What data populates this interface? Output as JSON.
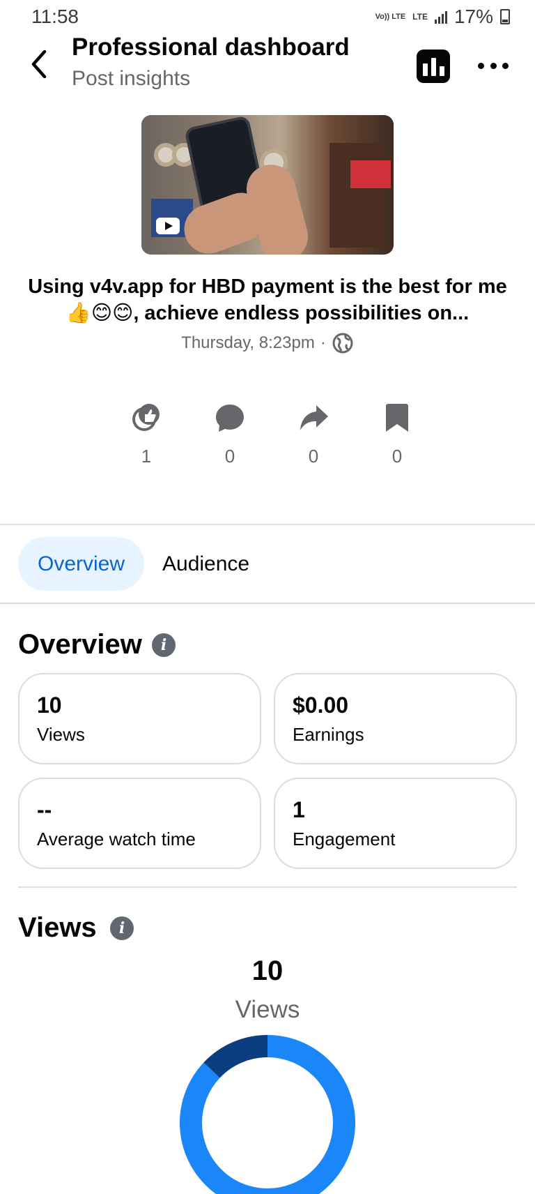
{
  "status_bar": {
    "time": "11:58",
    "volte": "Vo)) LTE",
    "lte": "LTE",
    "battery": "17%"
  },
  "header": {
    "title": "Professional dashboard",
    "subtitle": "Post insights"
  },
  "post": {
    "caption": "Using v4v.app for HBD payment is the best for me 👍😊😊, achieve endless possibilities on...",
    "time": "Thursday, 8:23pm",
    "separator": "·"
  },
  "engagement": [
    {
      "icon": "reactions-icon",
      "count": "1"
    },
    {
      "icon": "comment-icon",
      "count": "0"
    },
    {
      "icon": "share-icon",
      "count": "0"
    },
    {
      "icon": "bookmark-icon",
      "count": "0"
    }
  ],
  "tabs": {
    "overview": "Overview",
    "audience": "Audience",
    "active": "overview"
  },
  "overview": {
    "title": "Overview",
    "cards": [
      {
        "value": "10",
        "label": "Views"
      },
      {
        "value": "$0.00",
        "label": "Earnings"
      },
      {
        "value": "--",
        "label": "Average watch time"
      },
      {
        "value": "1",
        "label": "Engagement"
      }
    ]
  },
  "views": {
    "title": "Views",
    "total": "10",
    "total_label": "Views"
  },
  "chart_data": {
    "type": "pie",
    "values": [
      8.7,
      1.3
    ],
    "colors": [
      "#1b86f7",
      "#0a3e80"
    ]
  },
  "colors": {
    "accent": "#0866d0",
    "tab_active_bg": "#e7f3ff",
    "secondary_text": "#65676b"
  }
}
